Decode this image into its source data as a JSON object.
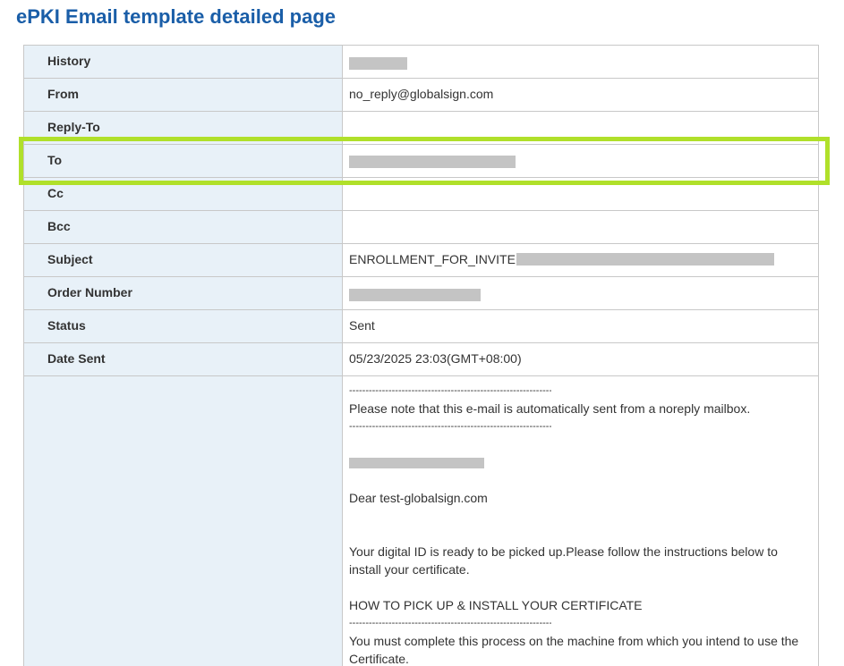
{
  "page": {
    "title": "ePKI Email template detailed page"
  },
  "fields": {
    "history_label": "History",
    "from_label": "From",
    "from_value": "no_reply@globalsign.com",
    "reply_to_label": "Reply-To",
    "to_label": "To",
    "cc_label": "Cc",
    "bcc_label": "Bcc",
    "subject_label": "Subject",
    "subject_value": "ENROLLMENT_FOR_INVITE",
    "order_number_label": "Order Number",
    "status_label": "Status",
    "status_value": "Sent",
    "date_sent_label": "Date Sent",
    "date_sent_value": "05/23/2025 23:03(GMT+08:00)"
  },
  "body": {
    "separator": "----------------------------------------------------------------",
    "notice": "Please note that this e-mail is automatically sent from a noreply mailbox.",
    "greeting": "Dear test-globalsign.com",
    "intro": "Your digital ID is ready to be picked up.Please follow the instructions below to install your certificate.",
    "howto_heading": "HOW TO PICK UP & INSTALL YOUR CERTIFICATE",
    "instruction": "You must complete this process on the machine from which you intend to use the Certificate."
  },
  "colors": {
    "title": "#1a5ea8",
    "label_background": "#e8f1f8",
    "highlight": "#b0e02a",
    "redaction": "#c4c4c4"
  }
}
